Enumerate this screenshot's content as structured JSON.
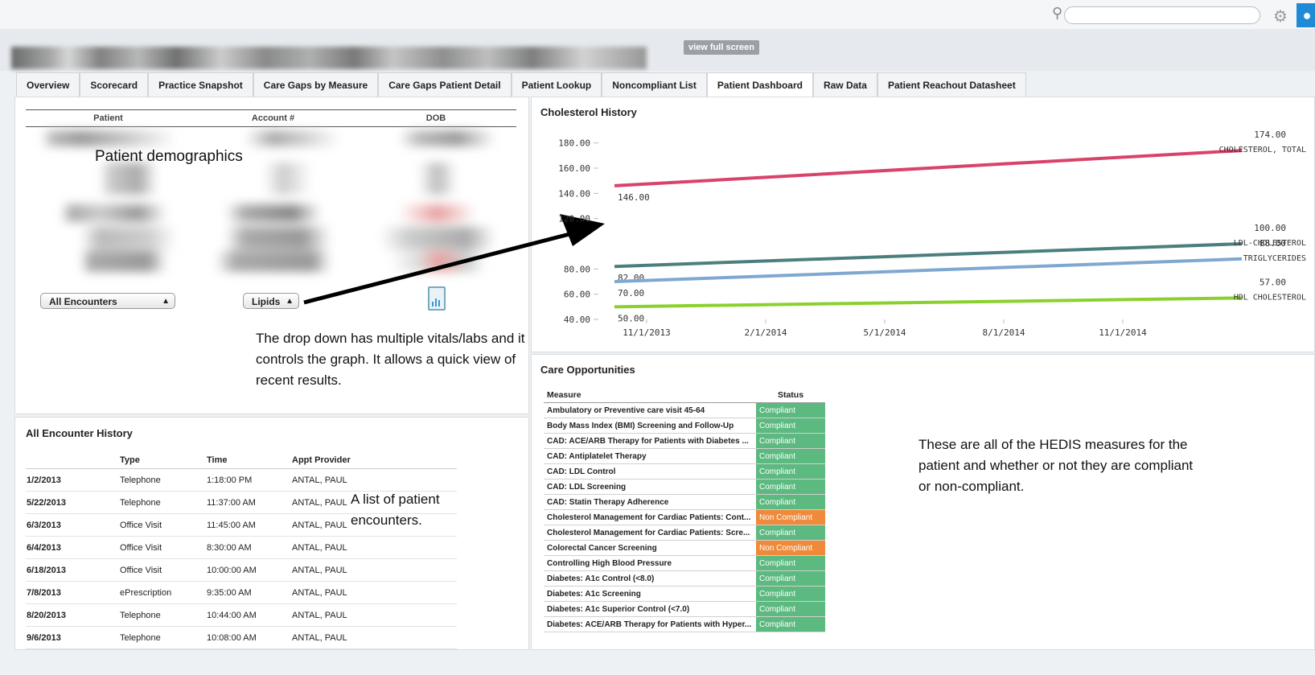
{
  "search": {
    "placeholder": ""
  },
  "header": {
    "fullscreen_label": "view full screen"
  },
  "tabs": [
    {
      "label": "Overview"
    },
    {
      "label": "Scorecard"
    },
    {
      "label": "Practice Snapshot"
    },
    {
      "label": "Care Gaps by Measure"
    },
    {
      "label": "Care Gaps Patient Detail"
    },
    {
      "label": "Patient Lookup"
    },
    {
      "label": "Noncompliant List"
    },
    {
      "label": "Patient Dashboard"
    },
    {
      "label": "Raw Data"
    },
    {
      "label": "Patient Reachout Datasheet"
    }
  ],
  "demographics": {
    "columns": [
      "Patient",
      "Account #",
      "DOB"
    ],
    "annotation": "Patient demographics"
  },
  "filters": {
    "encounters": "All Encounters",
    "metric": "Lipids"
  },
  "annotations": {
    "dropdown": "The drop down has multiple vitals/labs and it controls the graph. It allows a quick view of recent results.",
    "encounters": "A list of patient encounters.",
    "hedis": "These are all of the HEDIS measures for the patient and whether or not they are compliant or non-compliant."
  },
  "chart_data": {
    "type": "line",
    "title": "Cholesterol History",
    "x_ticks": [
      "11/1/2013",
      "2/1/2014",
      "5/1/2014",
      "8/1/2014",
      "11/1/2014"
    ],
    "y_ticks": [
      "40.00",
      "60.00",
      "80.00",
      "120.00",
      "140.00",
      "160.00",
      "180.00"
    ],
    "ylim": [
      40,
      190
    ],
    "series": [
      {
        "name": "CHOLESTEROL, TOTAL",
        "start": 146,
        "end": 174,
        "start_label": "146.00",
        "end_label": "174.00",
        "color": "#d9436a"
      },
      {
        "name": "LDL-CHOLESTEROL",
        "start": 82,
        "end": 100,
        "start_label": "82.00",
        "end_label": "100.00",
        "color": "#4a7f7d"
      },
      {
        "name": "TRIGLYCERIDES",
        "start": 70,
        "end": 88,
        "start_label": "70.00",
        "end_label": "88.00",
        "color": "#7fa8d0"
      },
      {
        "name": "HDL CHOLESTEROL",
        "start": 50,
        "end": 57,
        "start_label": "50.00",
        "end_label": "57.00",
        "color": "#8ad12e"
      }
    ]
  },
  "care": {
    "title": "Care Opportunities",
    "columns": [
      "Measure",
      "Status"
    ],
    "compliant_color": "#5cb97f",
    "noncompliant_color": "#ef8a3a",
    "rows": [
      {
        "measure": "Ambulatory or Preventive care visit 45-64",
        "status": "Compliant"
      },
      {
        "measure": "Body Mass Index (BMI) Screening and Follow-Up",
        "status": "Compliant"
      },
      {
        "measure": "CAD: ACE/ARB Therapy for Patients with Diabetes ...",
        "status": "Compliant"
      },
      {
        "measure": "CAD: Antiplatelet Therapy",
        "status": "Compliant"
      },
      {
        "measure": "CAD: LDL Control",
        "status": "Compliant"
      },
      {
        "measure": "CAD: LDL Screening",
        "status": "Compliant"
      },
      {
        "measure": "CAD: Statin Therapy Adherence",
        "status": "Compliant"
      },
      {
        "measure": "Cholesterol Management for Cardiac Patients: Cont...",
        "status": "Non Compliant"
      },
      {
        "measure": "Cholesterol Management for Cardiac Patients: Scre...",
        "status": "Compliant"
      },
      {
        "measure": "Colorectal Cancer Screening",
        "status": "Non Compliant"
      },
      {
        "measure": "Controlling High Blood Pressure",
        "status": "Compliant"
      },
      {
        "measure": "Diabetes: A1c Control (<8.0)",
        "status": "Compliant"
      },
      {
        "measure": "Diabetes: A1c Screening",
        "status": "Compliant"
      },
      {
        "measure": "Diabetes: A1c Superior Control (<7.0)",
        "status": "Compliant"
      },
      {
        "measure": "Diabetes: ACE/ARB Therapy for Patients with Hyper...",
        "status": "Compliant"
      }
    ]
  },
  "encounters": {
    "title": "All Encounter History",
    "columns": [
      "",
      "Type",
      "Time",
      "Appt Provider"
    ],
    "rows": [
      {
        "date": "1/2/2013",
        "type": "Telephone",
        "time": "1:18:00 PM",
        "provider": "ANTAL, PAUL"
      },
      {
        "date": "5/22/2013",
        "type": "Telephone",
        "time": "11:37:00 AM",
        "provider": "ANTAL, PAUL"
      },
      {
        "date": "6/3/2013",
        "type": "Office Visit",
        "time": "11:45:00 AM",
        "provider": "ANTAL, PAUL"
      },
      {
        "date": "6/4/2013",
        "type": "Office Visit",
        "time": "8:30:00 AM",
        "provider": "ANTAL, PAUL"
      },
      {
        "date": "6/18/2013",
        "type": "Office Visit",
        "time": "10:00:00 AM",
        "provider": "ANTAL, PAUL"
      },
      {
        "date": "7/8/2013",
        "type": "ePrescription",
        "time": "9:35:00 AM",
        "provider": "ANTAL, PAUL"
      },
      {
        "date": "8/20/2013",
        "type": "Telephone",
        "time": "10:44:00 AM",
        "provider": "ANTAL, PAUL"
      },
      {
        "date": "9/6/2013",
        "type": "Telephone",
        "time": "10:08:00 AM",
        "provider": "ANTAL, PAUL"
      }
    ]
  }
}
